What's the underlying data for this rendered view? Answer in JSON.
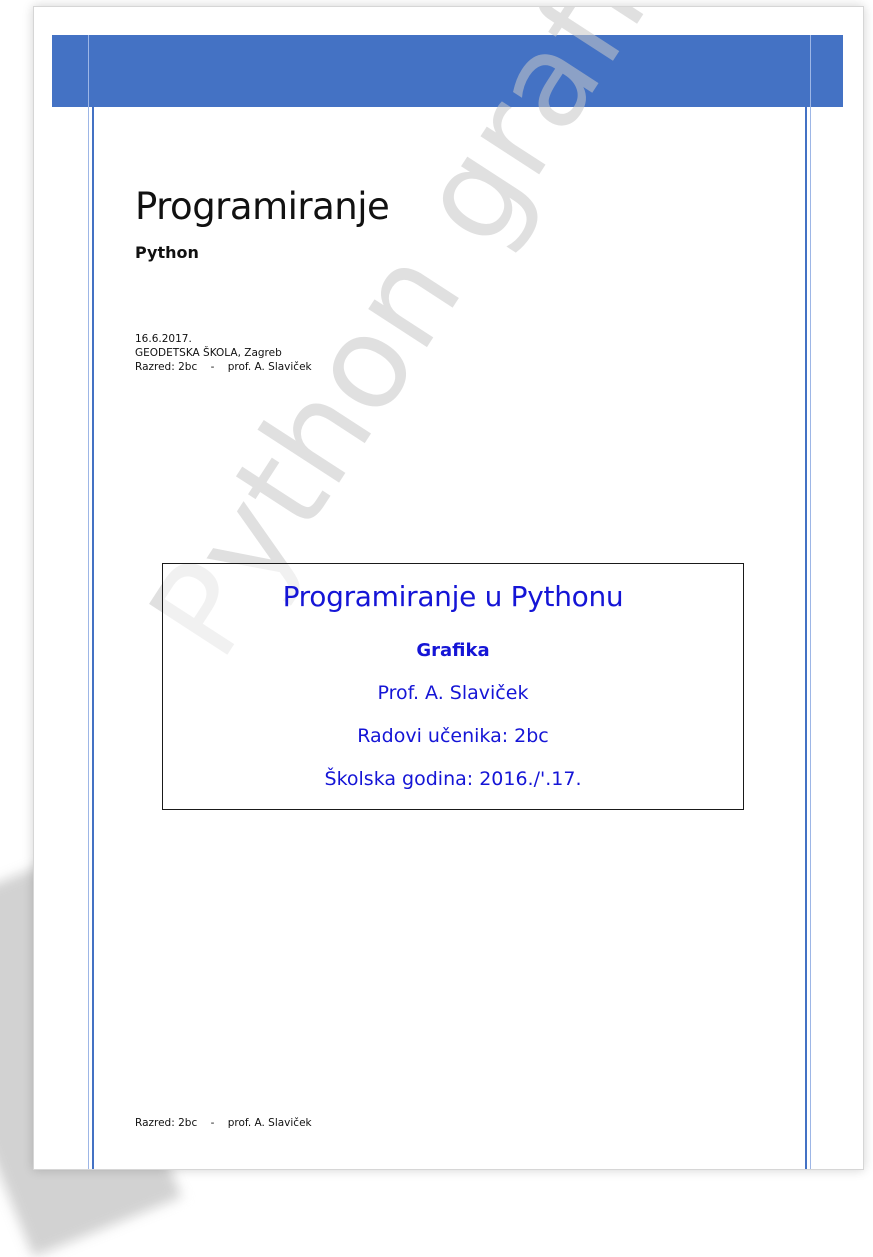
{
  "document": {
    "title": "Programiranje",
    "subtitle": "Python",
    "date": "16.6.2017.",
    "school": "GEODETSKA ŠKOLA, Zagreb",
    "class_line": "Razred: 2bc    -    prof. A. Slaviček",
    "watermark": "Python grafika"
  },
  "box": {
    "title": "Programiranje u Pythonu",
    "line1": "Grafika",
    "line2": "Prof. A. Slaviček",
    "line3": "Radovi učenika: 2bc",
    "line4": "Školska godina: 2016./'.17."
  },
  "footer": {
    "text": "Razred: 2bc    -    prof. A. Slaviček"
  },
  "colors": {
    "header_band": "#4472c4",
    "box_text": "#1515d6"
  }
}
